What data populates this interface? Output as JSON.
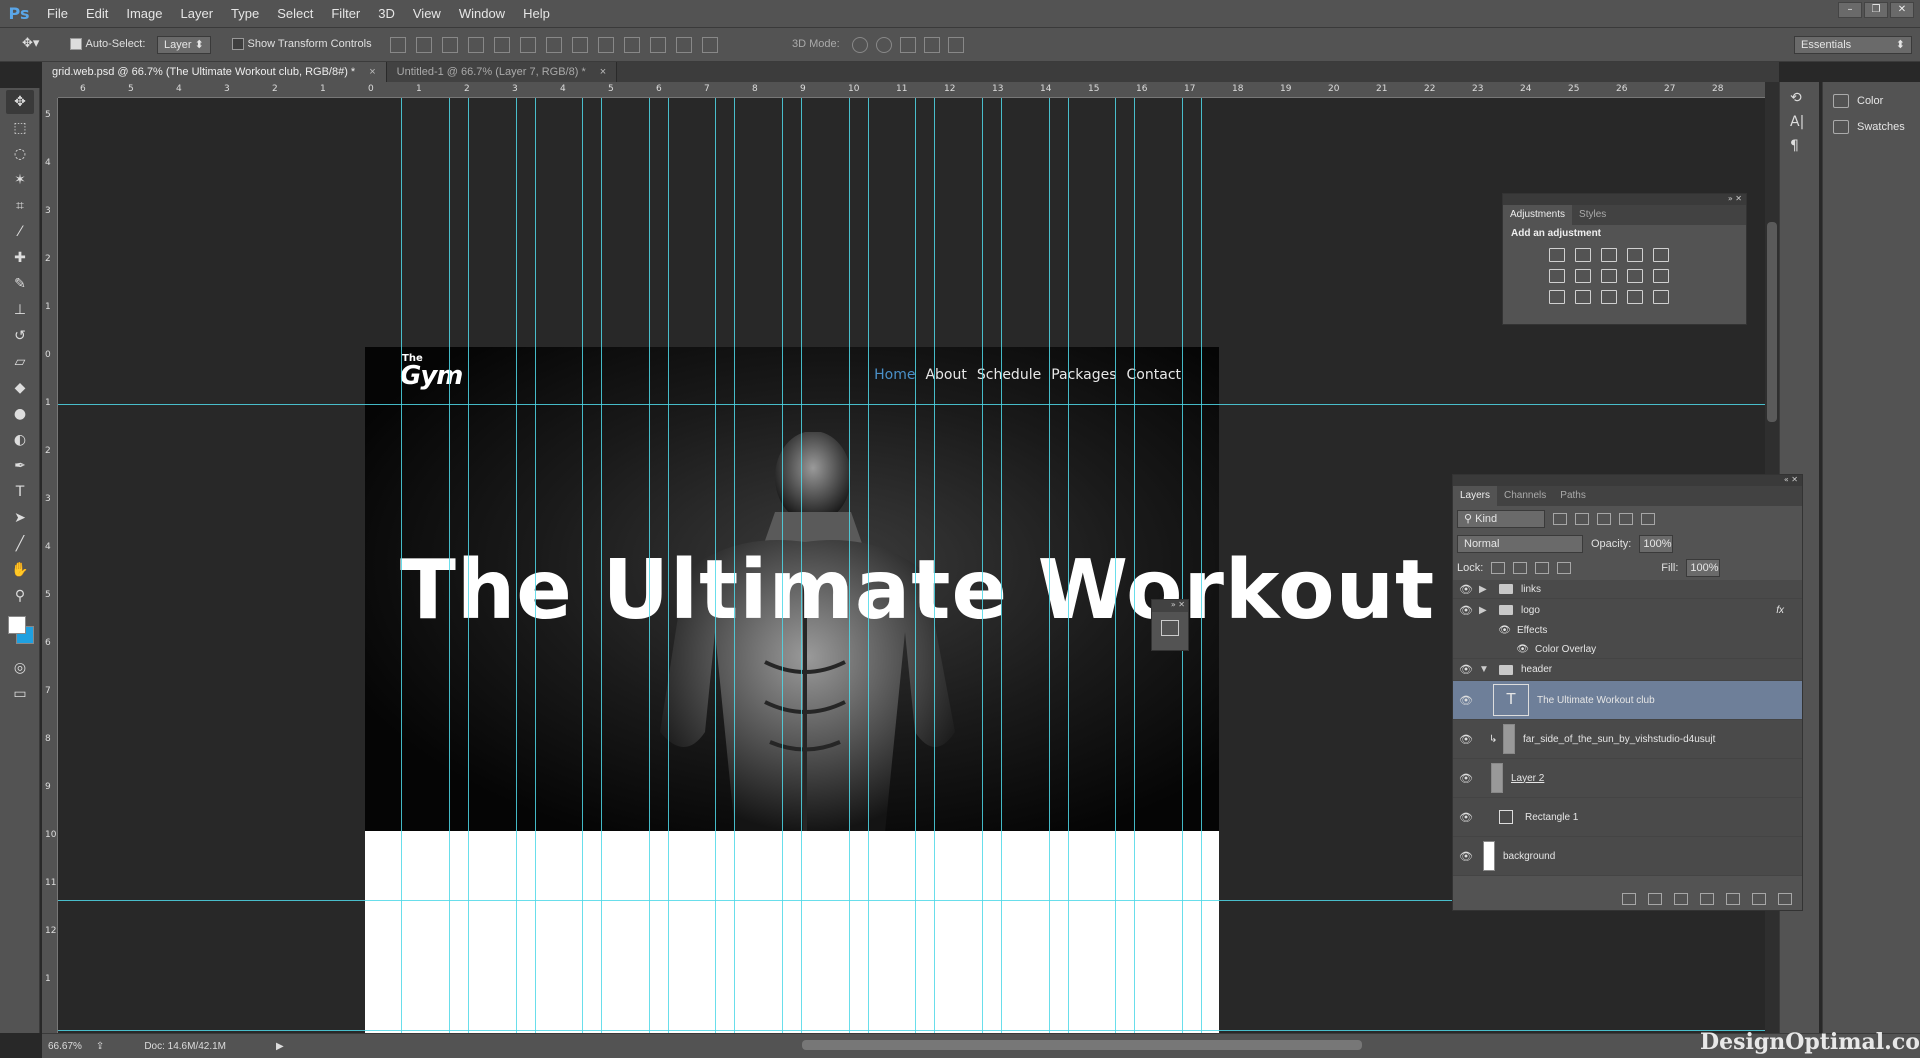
{
  "app": {
    "logo": "Ps"
  },
  "menu": [
    "File",
    "Edit",
    "Image",
    "Layer",
    "Type",
    "Select",
    "Filter",
    "3D",
    "View",
    "Window",
    "Help"
  ],
  "options": {
    "auto_select": "Auto-Select:",
    "auto_select_target": "Layer",
    "show_transform": "Show Transform Controls",
    "mode_3d": "3D Mode:",
    "workspace": "Essentials"
  },
  "tabs": [
    {
      "label": "grid.web.psd @ 66.7% (The Ultimate Workout club, RGB/8#) *",
      "close": "×"
    },
    {
      "label": "Untitled-1 @ 66.7% (Layer 7, RGB/8) *",
      "close": "×"
    }
  ],
  "ruler": {
    "h": [
      "6",
      "5",
      "4",
      "3",
      "2",
      "1",
      "0",
      "1",
      "2",
      "3",
      "4",
      "5",
      "6",
      "7",
      "8",
      "9",
      "10",
      "11",
      "12",
      "13",
      "14",
      "15",
      "16",
      "17",
      "18",
      "19",
      "20",
      "21",
      "22",
      "23",
      "24",
      "25",
      "26",
      "27",
      "28"
    ],
    "v": [
      "5",
      "4",
      "3",
      "2",
      "1",
      "0",
      "1",
      "2",
      "3",
      "4",
      "5",
      "6",
      "7",
      "8",
      "9",
      "10",
      "11",
      "12",
      "1"
    ]
  },
  "site": {
    "logo_small": "The",
    "logo_big": "Gym",
    "nav": [
      "Home",
      "About",
      "Schedule",
      "Packages",
      "Contact"
    ],
    "headline": "The Ultimate Workout"
  },
  "dock": {
    "color": "Color",
    "swatches": "Swatches"
  },
  "adjustments": {
    "tabs": [
      "Adjustments",
      "Styles"
    ],
    "heading": "Add an adjustment"
  },
  "layers": {
    "tabs": [
      "Layers",
      "Channels",
      "Paths"
    ],
    "kind": "Kind",
    "blend": "Normal",
    "opacity_label": "Opacity:",
    "opacity": "100%",
    "lock_label": "Lock:",
    "fill_label": "Fill:",
    "fill": "100%",
    "rows": {
      "links": "links",
      "logo": "logo",
      "effects": "Effects",
      "color_overlay": "Color Overlay",
      "header": "header",
      "text_layer": "The Ultimate Workout club",
      "sun": "far_side_of_the_sun_by_vishstudio-d4usujt",
      "layer2": "Layer 2",
      "rect": "Rectangle 1",
      "background": "background",
      "fx": "fx"
    }
  },
  "status": {
    "zoom": "66.67%",
    "doc": "Doc: 14.6M/42.1M"
  },
  "watermark": "DesignOptimal.com"
}
